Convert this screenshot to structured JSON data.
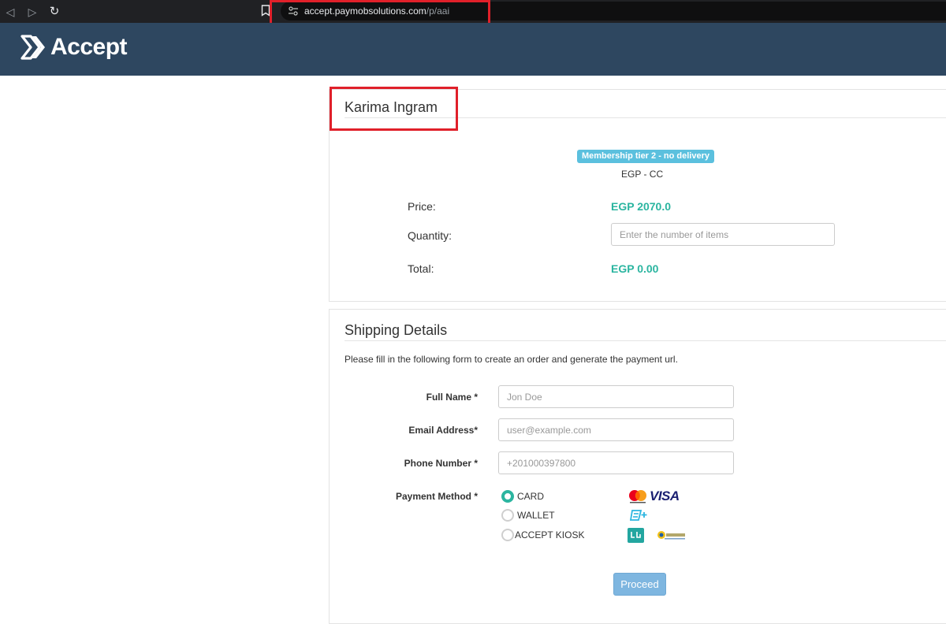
{
  "browser": {
    "url_host": "accept.paymobsolutions.com",
    "url_path": "/p/aai"
  },
  "header": {
    "brand": "Accept"
  },
  "product": {
    "merchant_name": "Karima Ingram",
    "badge": "Membership tier 2 - no delivery",
    "currency_method": "EGP - CC",
    "price_label": "Price:",
    "price_value": "EGP 2070.0",
    "quantity_label": "Quantity:",
    "quantity_placeholder": "Enter the number of items",
    "total_label": "Total:",
    "total_value": "EGP 0.00"
  },
  "shipping": {
    "title": "Shipping Details",
    "description": "Please fill in the following form to create an order and generate the payment url.",
    "full_name_label": "Full Name *",
    "full_name_placeholder": "Jon Doe",
    "email_label": "Email Address*",
    "email_placeholder": "user@example.com",
    "phone_label": "Phone Number *",
    "phone_placeholder": "+201000397800",
    "payment_label": "Payment Method *",
    "payment_methods": [
      {
        "label": "CARD",
        "selected": true,
        "icons": [
          "mastercard-icon",
          "visa-icon"
        ]
      },
      {
        "label": "WALLET",
        "selected": false,
        "icons": [
          "wallet-icon"
        ]
      },
      {
        "label": "ACCEPT KIOSK",
        "selected": false,
        "icons": [
          "aman-icon",
          "masary-icon"
        ]
      }
    ],
    "visa_text": "VISA",
    "proceed_label": "Proceed"
  },
  "colors": {
    "header_bg": "#2e4760",
    "accent": "#2bb5a0",
    "badge": "#5bc0de",
    "button": "#7eb6e0",
    "highlight": "#e0202a"
  }
}
